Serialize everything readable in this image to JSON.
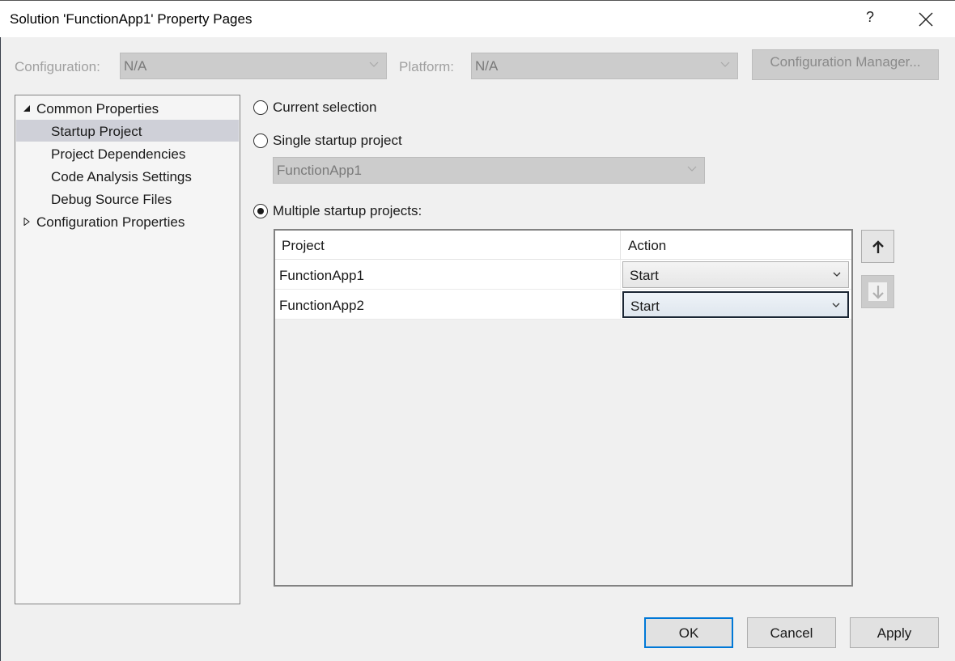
{
  "window": {
    "title": "Solution 'FunctionApp1' Property Pages",
    "help_label": "?",
    "close_icon": "close-icon"
  },
  "toolbar": {
    "configuration_label": "Configuration:",
    "configuration_value": "N/A",
    "platform_label": "Platform:",
    "platform_value": "N/A",
    "config_manager_label": "Configuration Manager..."
  },
  "tree": {
    "items": [
      {
        "label": "Common Properties",
        "level": 0,
        "expanded": true
      },
      {
        "label": "Startup Project",
        "level": 1,
        "selected": true
      },
      {
        "label": "Project Dependencies",
        "level": 1
      },
      {
        "label": "Code Analysis Settings",
        "level": 1
      },
      {
        "label": "Debug Source Files",
        "level": 1
      },
      {
        "label": "Configuration Properties",
        "level": 0,
        "expanded": false
      }
    ]
  },
  "startup": {
    "options": [
      {
        "label": "Current selection",
        "checked": false
      },
      {
        "label": "Single startup project",
        "checked": false
      },
      {
        "label": "Multiple startup projects:",
        "checked": true
      }
    ],
    "single_project_value": "FunctionApp1",
    "grid": {
      "columns": [
        "Project",
        "Action"
      ],
      "rows": [
        {
          "project": "FunctionApp1",
          "action": "Start"
        },
        {
          "project": "FunctionApp2",
          "action": "Start"
        }
      ]
    },
    "move_up_icon": "arrow-up-icon",
    "move_down_icon": "arrow-down-icon"
  },
  "buttons": {
    "ok": "OK",
    "cancel": "Cancel",
    "apply": "Apply"
  },
  "colors": {
    "default_button_border": "#0078d7",
    "selection_background": "#cfd0d8",
    "dialog_background": "#f0f0f0"
  }
}
